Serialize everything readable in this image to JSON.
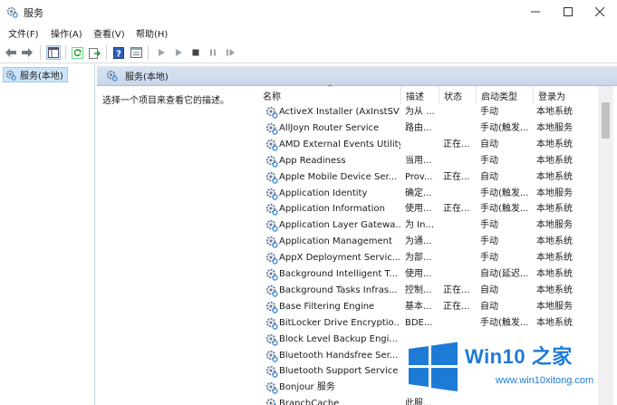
{
  "window": {
    "title": "服务"
  },
  "menu": [
    "文件(F)",
    "操作(A)",
    "查看(V)",
    "帮助(H)"
  ],
  "tree": {
    "root_label": "服务(本地)"
  },
  "panel": {
    "header_title": "服务(本地)",
    "description_hint": "选择一个项目来查看它的描述。"
  },
  "columns": {
    "name": "名称",
    "desc": "描述",
    "status": "状态",
    "startup": "启动类型",
    "logon": "登录为"
  },
  "services": [
    {
      "name": "ActiveX Installer (AxInstSV)",
      "desc": "为从 ...",
      "status": "",
      "startup": "手动",
      "logon": "本地系统"
    },
    {
      "name": "AllJoyn Router Service",
      "desc": "路由...",
      "status": "",
      "startup": "手动(触发...",
      "logon": "本地服务"
    },
    {
      "name": "AMD External Events Utility",
      "desc": "",
      "status": "正在...",
      "startup": "自动",
      "logon": "本地系统"
    },
    {
      "name": "App Readiness",
      "desc": "当用...",
      "status": "",
      "startup": "手动",
      "logon": "本地系统"
    },
    {
      "name": "Apple Mobile Device Ser...",
      "desc": "Prov...",
      "status": "正在...",
      "startup": "自动",
      "logon": "本地系统"
    },
    {
      "name": "Application Identity",
      "desc": "确定...",
      "status": "",
      "startup": "手动(触发...",
      "logon": "本地服务"
    },
    {
      "name": "Application Information",
      "desc": "使用...",
      "status": "正在...",
      "startup": "手动(触发...",
      "logon": "本地系统"
    },
    {
      "name": "Application Layer Gatewa...",
      "desc": "为 In...",
      "status": "",
      "startup": "手动",
      "logon": "本地服务"
    },
    {
      "name": "Application Management",
      "desc": "为通...",
      "status": "",
      "startup": "手动",
      "logon": "本地系统"
    },
    {
      "name": "AppX Deployment Servic...",
      "desc": "为部...",
      "status": "",
      "startup": "手动",
      "logon": "本地系统"
    },
    {
      "name": "Background Intelligent T...",
      "desc": "使用...",
      "status": "",
      "startup": "自动(延迟...",
      "logon": "本地系统"
    },
    {
      "name": "Background Tasks Infras...",
      "desc": "控制...",
      "status": "正在...",
      "startup": "自动",
      "logon": "本地系统"
    },
    {
      "name": "Base Filtering Engine",
      "desc": "基本...",
      "status": "正在...",
      "startup": "自动",
      "logon": "本地服务"
    },
    {
      "name": "BitLocker Drive Encryptio...",
      "desc": "BDE...",
      "status": "",
      "startup": "手动(触发...",
      "logon": "本地系统"
    },
    {
      "name": "Block Level Backup Engi...",
      "desc": "",
      "status": "",
      "startup": "",
      "logon": ""
    },
    {
      "name": "Bluetooth Handsfree Ser...",
      "desc": "",
      "status": "",
      "startup": "",
      "logon": ""
    },
    {
      "name": "Bluetooth Support Service",
      "desc": "",
      "status": "",
      "startup": "",
      "logon": ""
    },
    {
      "name": "Bonjour 服务",
      "desc": "",
      "status": "",
      "startup": "",
      "logon": ""
    },
    {
      "name": "BranchCache",
      "desc": "此服...",
      "status": "",
      "startup": "",
      "logon": ""
    }
  ],
  "watermark": {
    "title": "Win10 之家",
    "url": "www.win10xitong.com"
  },
  "colors": {
    "accent": "#1d7bd6",
    "header": "#d0dded",
    "selection": "#cce4f7"
  }
}
